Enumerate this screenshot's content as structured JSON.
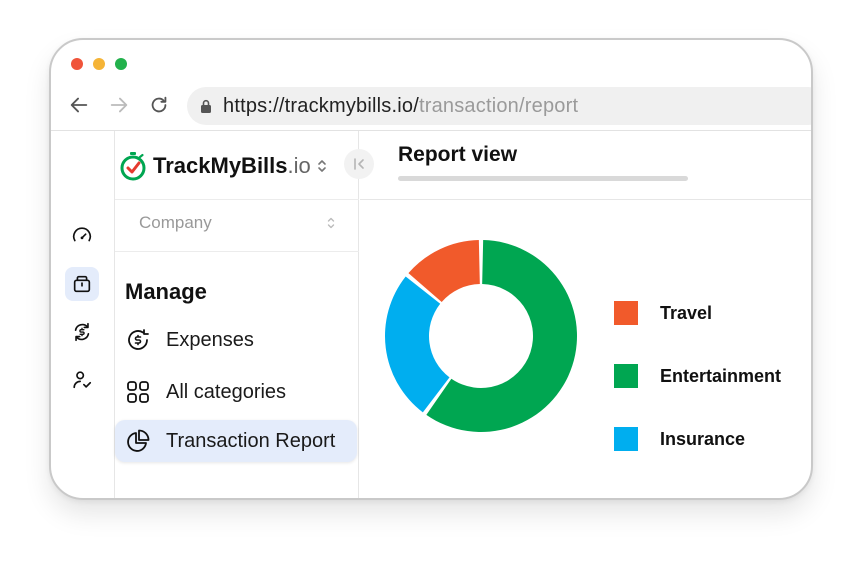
{
  "browser": {
    "url_host": "https://trackmybills.io/",
    "url_path": "transaction/report"
  },
  "sidebar": {
    "brand_name": "TrackMyBills",
    "brand_tld": ".io",
    "company_placeholder": "Company",
    "section_title": "Manage",
    "items": [
      {
        "label": "Expenses",
        "icon": "dollar-refresh-icon"
      },
      {
        "label": "All categories",
        "icon": "grid-icon"
      },
      {
        "label": "Transaction Report",
        "icon": "pie-chart-icon",
        "active": true
      }
    ]
  },
  "rail": {
    "icons": [
      "speedometer-icon",
      "wallet-icon",
      "dollar-cycle-icon",
      "user-check-icon"
    ],
    "active_index": 1
  },
  "main": {
    "title": "Report view"
  },
  "colors": {
    "travel": "#f15a2b",
    "entertainment": "#00a651",
    "insurance": "#00aeef",
    "active_bg": "#e4ecfb"
  },
  "chart_data": {
    "type": "pie",
    "categories": [
      "Travel",
      "Entertainment",
      "Insurance"
    ],
    "values": [
      14,
      60,
      26
    ],
    "colors": [
      "#f15a2b",
      "#00a651",
      "#00aeef"
    ],
    "title": "",
    "legend": "right"
  }
}
